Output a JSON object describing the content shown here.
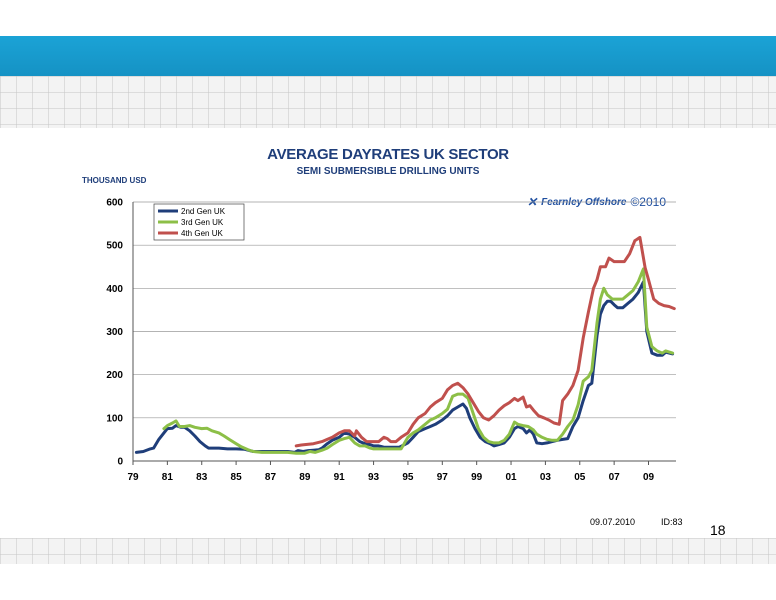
{
  "slide": {
    "page_number": "18",
    "date": "09.07.2010",
    "id": "ID:83",
    "brand": {
      "logo_icon": "crossed-arrows-logo-icon",
      "name": "Fearnley Offshore",
      "copyright": "©2010"
    },
    "colors": {
      "band": "#1ba3d6",
      "title": "#1f3e7a"
    }
  },
  "chart_data": {
    "type": "line",
    "title": "AVERAGE DAYRATES UK SECTOR",
    "subtitle": "SEMI SUBMERSIBLE DRILLING UNITS",
    "ylabel": "THOUSAND USD",
    "xlabel": "",
    "xlim": [
      1979,
      2010.6
    ],
    "ylim": [
      0,
      600
    ],
    "y_ticks": [
      0,
      100,
      200,
      300,
      400,
      500,
      600
    ],
    "x_ticks": [
      1979,
      1981,
      1983,
      1985,
      1987,
      1989,
      1991,
      1993,
      1995,
      1997,
      1999,
      2001,
      2003,
      2005,
      2007,
      2009
    ],
    "x_tick_labels": [
      "79",
      "81",
      "83",
      "85",
      "87",
      "89",
      "91",
      "93",
      "95",
      "97",
      "99",
      "01",
      "03",
      "05",
      "07",
      "09"
    ],
    "grid": "horizontal",
    "legend": "top-left",
    "series": [
      {
        "name": "2nd Gen UK",
        "color": "#1f3e7a",
        "points": [
          [
            1979.2,
            20
          ],
          [
            1979.6,
            22
          ],
          [
            1980.0,
            28
          ],
          [
            1980.2,
            30
          ],
          [
            1980.5,
            50
          ],
          [
            1980.8,
            65
          ],
          [
            1981.0,
            75
          ],
          [
            1981.3,
            76
          ],
          [
            1981.5,
            82
          ],
          [
            1981.8,
            78
          ],
          [
            1982.0,
            78
          ],
          [
            1982.3,
            70
          ],
          [
            1982.6,
            58
          ],
          [
            1982.9,
            45
          ],
          [
            1983.2,
            35
          ],
          [
            1983.4,
            30
          ],
          [
            1983.7,
            30
          ],
          [
            1984.0,
            30
          ],
          [
            1984.5,
            28
          ],
          [
            1985.0,
            28
          ],
          [
            1985.5,
            27
          ],
          [
            1986.0,
            22
          ],
          [
            1986.5,
            22
          ],
          [
            1987.0,
            22
          ],
          [
            1987.5,
            22
          ],
          [
            1988.0,
            22
          ],
          [
            1988.4,
            20
          ],
          [
            1988.6,
            24
          ],
          [
            1988.9,
            22
          ],
          [
            1989.2,
            24
          ],
          [
            1989.5,
            25
          ],
          [
            1989.8,
            26
          ],
          [
            1990.0,
            30
          ],
          [
            1990.3,
            40
          ],
          [
            1990.6,
            48
          ],
          [
            1991.0,
            55
          ],
          [
            1991.3,
            65
          ],
          [
            1991.6,
            62
          ],
          [
            1991.9,
            55
          ],
          [
            1992.2,
            45
          ],
          [
            1992.5,
            40
          ],
          [
            1992.8,
            38
          ],
          [
            1993.0,
            35
          ],
          [
            1993.3,
            35
          ],
          [
            1993.6,
            32
          ],
          [
            1993.9,
            32
          ],
          [
            1994.2,
            32
          ],
          [
            1994.5,
            32
          ],
          [
            1994.8,
            38
          ],
          [
            1995.0,
            42
          ],
          [
            1995.3,
            55
          ],
          [
            1995.6,
            68
          ],
          [
            1996.0,
            75
          ],
          [
            1996.3,
            80
          ],
          [
            1996.6,
            85
          ],
          [
            1997.0,
            95
          ],
          [
            1997.3,
            105
          ],
          [
            1997.6,
            118
          ],
          [
            1997.9,
            125
          ],
          [
            1998.2,
            132
          ],
          [
            1998.4,
            122
          ],
          [
            1998.6,
            100
          ],
          [
            1998.9,
            75
          ],
          [
            1999.2,
            55
          ],
          [
            1999.5,
            45
          ],
          [
            1999.8,
            40
          ],
          [
            2000.0,
            35
          ],
          [
            2000.3,
            38
          ],
          [
            2000.6,
            42
          ],
          [
            2000.9,
            55
          ],
          [
            2001.2,
            75
          ],
          [
            2001.4,
            80
          ],
          [
            2001.7,
            75
          ],
          [
            2001.9,
            65
          ],
          [
            2002.1,
            72
          ],
          [
            2002.3,
            62
          ],
          [
            2002.5,
            42
          ],
          [
            2002.8,
            40
          ],
          [
            2003.1,
            42
          ],
          [
            2003.4,
            45
          ],
          [
            2003.7,
            48
          ],
          [
            2004.0,
            50
          ],
          [
            2004.3,
            52
          ],
          [
            2004.6,
            80
          ],
          [
            2004.9,
            100
          ],
          [
            2005.2,
            140
          ],
          [
            2005.5,
            175
          ],
          [
            2005.7,
            180
          ],
          [
            2006.0,
            290
          ],
          [
            2006.2,
            340
          ],
          [
            2006.4,
            360
          ],
          [
            2006.6,
            370
          ],
          [
            2006.8,
            370
          ],
          [
            2007.0,
            362
          ],
          [
            2007.2,
            355
          ],
          [
            2007.5,
            355
          ],
          [
            2007.8,
            365
          ],
          [
            2008.1,
            375
          ],
          [
            2008.4,
            390
          ],
          [
            2008.7,
            415
          ],
          [
            2008.9,
            300
          ],
          [
            2009.2,
            250
          ],
          [
            2009.5,
            245
          ],
          [
            2009.8,
            245
          ],
          [
            2010.0,
            252
          ],
          [
            2010.4,
            248
          ]
        ]
      },
      {
        "name": "3rd Gen UK",
        "color": "#8cbf47",
        "points": [
          [
            1980.8,
            75
          ],
          [
            1981.0,
            82
          ],
          [
            1981.3,
            88
          ],
          [
            1981.5,
            93
          ],
          [
            1981.7,
            80
          ],
          [
            1982.0,
            80
          ],
          [
            1982.3,
            82
          ],
          [
            1982.6,
            78
          ],
          [
            1983.0,
            75
          ],
          [
            1983.3,
            76
          ],
          [
            1983.6,
            70
          ],
          [
            1984.0,
            65
          ],
          [
            1984.3,
            58
          ],
          [
            1984.6,
            50
          ],
          [
            1985.0,
            40
          ],
          [
            1985.3,
            33
          ],
          [
            1985.7,
            26
          ],
          [
            1986.0,
            22
          ],
          [
            1986.5,
            20
          ],
          [
            1987.0,
            20
          ],
          [
            1987.5,
            20
          ],
          [
            1988.0,
            20
          ],
          [
            1988.5,
            18
          ],
          [
            1989.0,
            18
          ],
          [
            1989.3,
            22
          ],
          [
            1989.6,
            20
          ],
          [
            1990.0,
            25
          ],
          [
            1990.3,
            30
          ],
          [
            1990.6,
            38
          ],
          [
            1991.0,
            48
          ],
          [
            1991.3,
            52
          ],
          [
            1991.6,
            55
          ],
          [
            1991.9,
            42
          ],
          [
            1992.2,
            35
          ],
          [
            1992.5,
            35
          ],
          [
            1992.8,
            30
          ],
          [
            1993.0,
            28
          ],
          [
            1993.3,
            28
          ],
          [
            1993.6,
            28
          ],
          [
            1994.0,
            28
          ],
          [
            1994.3,
            28
          ],
          [
            1994.6,
            28
          ],
          [
            1995.0,
            55
          ],
          [
            1995.3,
            65
          ],
          [
            1995.6,
            72
          ],
          [
            1996.0,
            85
          ],
          [
            1996.3,
            95
          ],
          [
            1996.6,
            100
          ],
          [
            1997.0,
            110
          ],
          [
            1997.3,
            120
          ],
          [
            1997.6,
            150
          ],
          [
            1997.9,
            155
          ],
          [
            1998.2,
            155
          ],
          [
            1998.5,
            145
          ],
          [
            1998.8,
            110
          ],
          [
            1999.1,
            75
          ],
          [
            1999.4,
            55
          ],
          [
            1999.7,
            45
          ],
          [
            2000.0,
            42
          ],
          [
            2000.3,
            42
          ],
          [
            2000.6,
            48
          ],
          [
            2000.9,
            62
          ],
          [
            2001.2,
            90
          ],
          [
            2001.4,
            85
          ],
          [
            2001.7,
            82
          ],
          [
            2002.0,
            80
          ],
          [
            2002.3,
            72
          ],
          [
            2002.5,
            62
          ],
          [
            2002.8,
            55
          ],
          [
            2003.1,
            50
          ],
          [
            2003.4,
            48
          ],
          [
            2003.7,
            48
          ],
          [
            2004.0,
            62
          ],
          [
            2004.3,
            80
          ],
          [
            2004.6,
            95
          ],
          [
            2004.9,
            130
          ],
          [
            2005.2,
            185
          ],
          [
            2005.5,
            195
          ],
          [
            2005.7,
            210
          ],
          [
            2006.0,
            320
          ],
          [
            2006.2,
            375
          ],
          [
            2006.4,
            400
          ],
          [
            2006.6,
            385
          ],
          [
            2006.9,
            375
          ],
          [
            2007.2,
            375
          ],
          [
            2007.5,
            375
          ],
          [
            2007.8,
            385
          ],
          [
            2008.1,
            395
          ],
          [
            2008.4,
            415
          ],
          [
            2008.7,
            445
          ],
          [
            2008.9,
            310
          ],
          [
            2009.2,
            265
          ],
          [
            2009.5,
            255
          ],
          [
            2009.8,
            250
          ],
          [
            2010.0,
            255
          ],
          [
            2010.4,
            250
          ]
        ]
      },
      {
        "name": "4th Gen UK",
        "color": "#c0504d",
        "points": [
          [
            1988.5,
            35
          ],
          [
            1988.8,
            37
          ],
          [
            1989.0,
            38
          ],
          [
            1989.5,
            40
          ],
          [
            1990.0,
            45
          ],
          [
            1990.3,
            50
          ],
          [
            1990.6,
            55
          ],
          [
            1991.0,
            65
          ],
          [
            1991.3,
            70
          ],
          [
            1991.6,
            70
          ],
          [
            1991.9,
            58
          ],
          [
            1992.0,
            70
          ],
          [
            1992.3,
            55
          ],
          [
            1992.6,
            45
          ],
          [
            1993.0,
            45
          ],
          [
            1993.3,
            45
          ],
          [
            1993.6,
            55
          ],
          [
            1993.8,
            52
          ],
          [
            1994.0,
            45
          ],
          [
            1994.3,
            45
          ],
          [
            1994.6,
            55
          ],
          [
            1995.0,
            65
          ],
          [
            1995.3,
            85
          ],
          [
            1995.6,
            100
          ],
          [
            1996.0,
            110
          ],
          [
            1996.3,
            125
          ],
          [
            1996.6,
            135
          ],
          [
            1997.0,
            145
          ],
          [
            1997.3,
            165
          ],
          [
            1997.6,
            175
          ],
          [
            1997.9,
            180
          ],
          [
            1998.2,
            170
          ],
          [
            1998.5,
            155
          ],
          [
            1998.8,
            135
          ],
          [
            1999.1,
            115
          ],
          [
            1999.4,
            100
          ],
          [
            1999.7,
            95
          ],
          [
            2000.0,
            105
          ],
          [
            2000.3,
            118
          ],
          [
            2000.6,
            128
          ],
          [
            2000.9,
            135
          ],
          [
            2001.2,
            145
          ],
          [
            2001.4,
            140
          ],
          [
            2001.7,
            148
          ],
          [
            2001.9,
            125
          ],
          [
            2002.1,
            128
          ],
          [
            2002.3,
            118
          ],
          [
            2002.6,
            105
          ],
          [
            2002.9,
            100
          ],
          [
            2003.2,
            95
          ],
          [
            2003.5,
            88
          ],
          [
            2003.8,
            85
          ],
          [
            2004.0,
            140
          ],
          [
            2004.3,
            155
          ],
          [
            2004.6,
            175
          ],
          [
            2004.9,
            210
          ],
          [
            2005.2,
            285
          ],
          [
            2005.5,
            345
          ],
          [
            2005.8,
            400
          ],
          [
            2006.0,
            420
          ],
          [
            2006.2,
            450
          ],
          [
            2006.5,
            450
          ],
          [
            2006.7,
            470
          ],
          [
            2007.0,
            462
          ],
          [
            2007.3,
            462
          ],
          [
            2007.6,
            462
          ],
          [
            2007.9,
            480
          ],
          [
            2008.2,
            510
          ],
          [
            2008.5,
            518
          ],
          [
            2008.8,
            448
          ],
          [
            2009.0,
            420
          ],
          [
            2009.3,
            375
          ],
          [
            2009.6,
            365
          ],
          [
            2009.9,
            360
          ],
          [
            2010.2,
            358
          ],
          [
            2010.5,
            353
          ]
        ]
      }
    ]
  }
}
